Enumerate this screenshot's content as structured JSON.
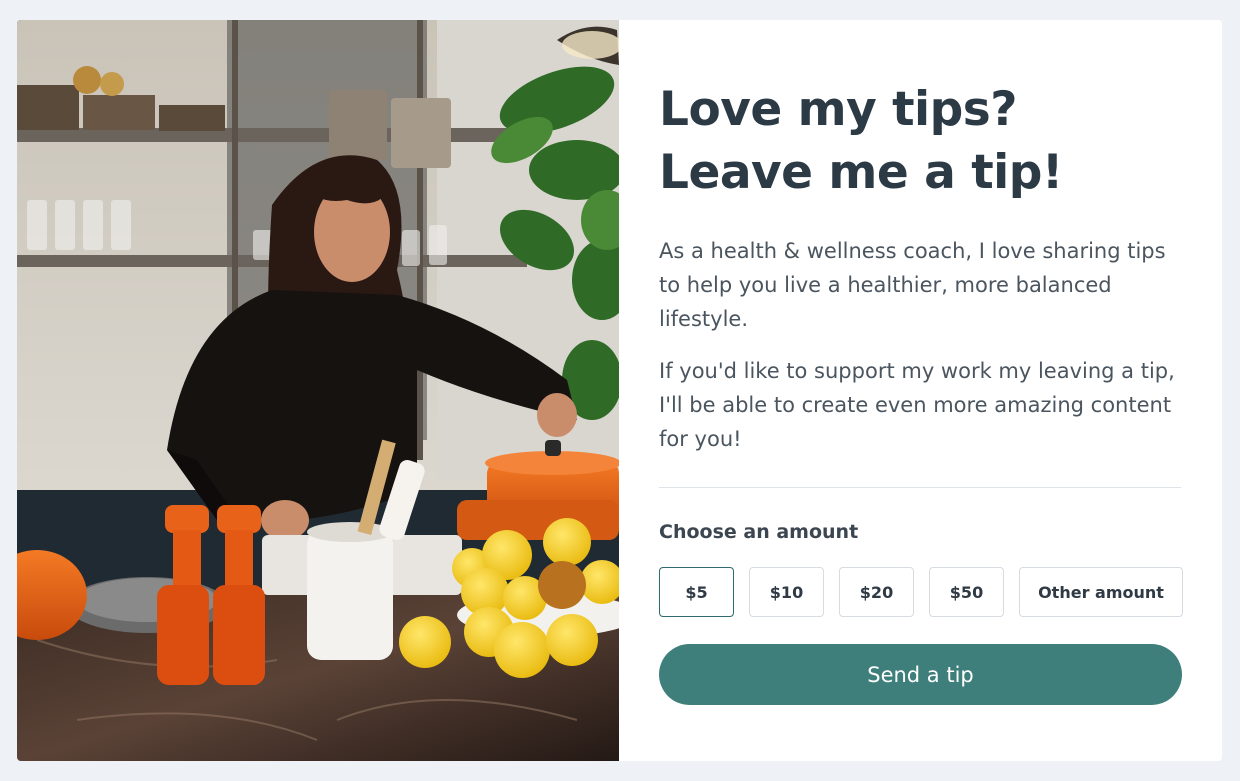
{
  "hero_image": {
    "alt": "Woman cooking in kitchen with lemons and orange pots",
    "icon": "photo"
  },
  "title": "Love my tips? Leave me a tip!",
  "paragraphs": [
    "As a health & wellness coach, I love sharing tips to help you live a healthier, more balanced lifestyle.",
    "If you'd like to support my work my leaving a tip, I'll be able to create even more amazing content for you!"
  ],
  "choose_label": "Choose an amount",
  "amounts": [
    {
      "label": "$5",
      "selected": true
    },
    {
      "label": "$10",
      "selected": false
    },
    {
      "label": "$20",
      "selected": false
    },
    {
      "label": "$50",
      "selected": false
    },
    {
      "label": "Other amount",
      "selected": false
    }
  ],
  "send_button": "Send a tip",
  "colors": {
    "page_bg": "#eef2f6",
    "card_bg": "#ffffff",
    "accent": "#3f7f7b",
    "title": "#2c3a46",
    "body_text": "#4a555f"
  }
}
